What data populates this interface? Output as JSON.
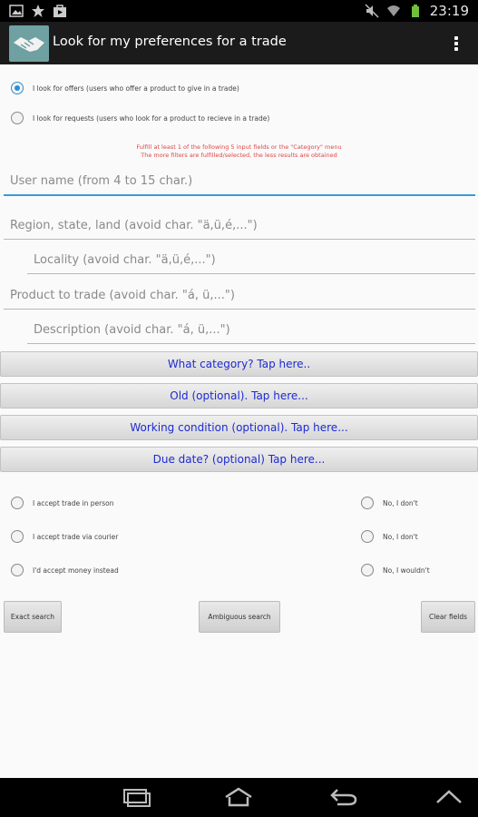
{
  "status_bar": {
    "time": "23:19"
  },
  "app": {
    "title": "Look for my preferences for a trade"
  },
  "mode_options": [
    {
      "label": "I look for offers (users who offer a product to give in a trade)",
      "selected": true
    },
    {
      "label": "I look for requests (users who look for a product to recieve in a trade)",
      "selected": false
    }
  ],
  "notice": {
    "line1": "Fulfill at least 1 of the following 5 input fields or the \"Category\" menu",
    "line2": "The more filters are fulfilled/selected, the less results are obtained"
  },
  "fields": {
    "user_name": "User name (from 4 to 15 char.)",
    "region": "Region, state, land (avoid char. \"ä,ü,é,...\")",
    "locality": "Locality (avoid char. \"ä,ü,é,...\")",
    "product": "Product to trade (avoid char. \"á, ü,...\")",
    "description": "Description (avoid char. \"á, ü,...\")"
  },
  "menu_buttons": {
    "category": "What category? Tap here..",
    "old": "Old (optional). Tap here...",
    "condition": "Working condition (optional). Tap here...",
    "due_date": "Due date? (optional) Tap here..."
  },
  "accept_options": [
    {
      "label": "I accept trade in person",
      "deny": "No, I don't"
    },
    {
      "label": "I accept trade via courier",
      "deny": "No, I don't"
    },
    {
      "label": "I'd accept money instead",
      "deny": "No, I wouldn't"
    }
  ],
  "actions": {
    "exact": "Exact search",
    "ambiguous": "Ambiguous search",
    "clear": "Clear fields"
  },
  "colors": {
    "accent": "#2a8ed8",
    "button_text": "#1d2bd1",
    "notice": "#e04545"
  }
}
